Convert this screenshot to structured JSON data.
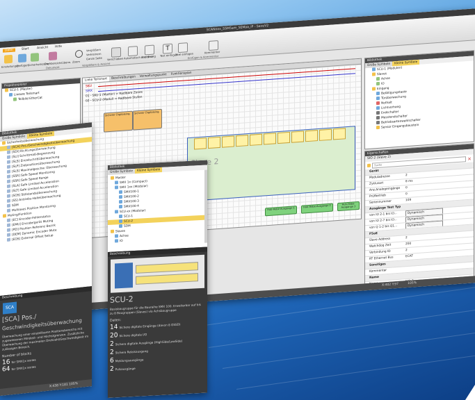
{
  "main": {
    "title": "SCANnex_SSM5am_5EMaa_iP - SaveV2",
    "ribbon_tabs": [
      "Datei",
      "Start",
      "Ansicht",
      "Hilfe"
    ],
    "ribbon": {
      "b1": "Einstellungen",
      "b2": "Einfügen",
      "b3": "Sicherheitszone",
      "b4": "Drehbereichsüberw.",
      "zoom_label": "Zoom",
      "vergroessern": "Vergrößern",
      "verkleinern": "Verkleinern",
      "ganzseite": "Ganze Seite",
      "verschieben": "Verschieben",
      "automatisch": "Automatisch anordnen",
      "anordnung": "Anordnung",
      "text": "Text einfügen",
      "titel": "Titel einfügen",
      "kommentar": "Kommentar",
      "drucken": "Drucken",
      "group_ansicht": "Vergrößern & Ansicht",
      "group_kommentar": "Einfügen & Kommentar",
      "dokument": "Dokument"
    },
    "project_tree": {
      "title": "Projektexplorer",
      "items": [
        "SCU-1 (Master)",
        "Lineare Teilsmart",
        "Teilbild EtherCat"
      ]
    },
    "canvas": {
      "tabs": [
        "Linke Teilsmart",
        "Beschreibungen",
        "Verwaltungspunkt",
        "Funktionsplan"
      ],
      "row1": "SKU",
      "row2": "SMX",
      "row3": "01 - SKU-1 (Master) > Radlbare Zones",
      "row4": "02 - SCU-2 (Modul) > Radlbare Stufen",
      "zone_label": "Slave 2",
      "green_block_1": "Hub-Hebe-Ausgänge 1",
      "green_block_2": "Hub-Hebe-Ausgänge 2",
      "green_block_3": "Hub-Hebe-Ausgänge 3",
      "module_a": "Sicherer Digitaleing.",
      "module_b": "Sicherer Digitaleing."
    },
    "library": {
      "title": "Bibliothek",
      "tab_big": "Große Symbole",
      "tab_small": "Kleine Symbole",
      "items": [
        "SCU-1 (Modulen)",
        "Slaves",
        "Achse",
        "IO",
        "Eingang",
        "Betätigungstaste",
        "Türüberwachung",
        "Nothalt",
        "Lichtvorhang",
        "Endschalter",
        "Messtendschalter",
        "Betriebsartenwahlschalter",
        "Sensor Eingangsbaustein"
      ]
    },
    "properties": {
      "title": "Eigenschaften",
      "header": "SIO-2 (Slave 2)",
      "search_placeholder": "Suche",
      "sections": {
        "geraet": "Gerät",
        "ausgaenge": "Ausgänge Test Typ",
        "fsoe": "FSoE",
        "sonstiges": "Sonstiges",
        "name": "Name"
      },
      "rows": [
        {
          "k": "Moduladresse",
          "v": "2"
        },
        {
          "k": "Zyklusart",
          "v": "8 ms"
        },
        {
          "k": "Anz.Analogeingänge",
          "v": "0"
        },
        {
          "k": "Prüfbetrieb",
          "v": "0"
        },
        {
          "k": "Seriennummer",
          "v": "109"
        }
      ],
      "test_rows": [
        {
          "k": "von IO 2-1 bis IO...",
          "v": "Dynamisch"
        },
        {
          "k": "von IO 2-7 bis IO...",
          "v": "Dynamisch"
        },
        {
          "k": "von Q 1-2 bis Q1...",
          "v": "Dynamisch"
        }
      ],
      "fsoe_rows": [
        {
          "k": "Slave Address",
          "v": "2"
        },
        {
          "k": "Watchdog Zeit",
          "v": "200"
        },
        {
          "k": "Verbindung ID",
          "v": "2"
        },
        {
          "k": "RT Ethernet Bus",
          "v": "ECAT"
        }
      ],
      "kommentar_label": "Kommentar",
      "name_label": "Name",
      "name_value": "SIO-2"
    },
    "status": {
      "coords": "X:402 Y:97",
      "zoom": "105%"
    }
  },
  "left_win": {
    "title": "Bibliothek",
    "tab_big": "Große Symbole",
    "tab_small": "Kleine Symbole",
    "root": "Sicherheitsüberwachung",
    "items": [
      "[SCA] Pos./Geschwindigkeitsüberwachung",
      "[SDI] Richtungsüberwachung",
      "[SLI] Schrittmaß-Begrenzung",
      "[SLS] Einzelschrittüberwachung",
      "[SLP] Zielpositionsüberwachung",
      "[SLS] Maximalgeschw. Überwachung",
      "[SSR] Safe Speed Monitoring",
      "[SSR] Safe Speed Range",
      "[SLA] Safe Limited Acceleration",
      "[SLT] Safe Limited Acceleration",
      "[SOS] Stillstandsüberwachung",
      "[SS] Antriebs-Halteüberwachung",
      "SDM",
      "Multiaxes Position Monitoring",
      "Muting/Funktion",
      "[EC] Encoder-Fehlerstatus",
      "[EMU] Encodergerät Muting",
      "[PEI] Position Referenz Bezirk",
      "[DEM] Dynamic Encoder Mute",
      "[EOS] External Offset Setup"
    ],
    "desc_title": "Beschreibung",
    "desc_badge": "SCA",
    "desc_heading1": "[SCA] Pos./",
    "desc_heading2": "Geschwindigkeitsüberwachung",
    "desc_text": "Überwachung einer einstellbaren Positionsbereichs mit zugewiesenen Mindest- und Höchstgrenzen. Zusätzliche Überwachung der maximalen Drehzahl/Geschwindigkeit im zulässigen Bereich.",
    "blocks_label": "Number of blocks",
    "blocks": [
      {
        "n": "16",
        "t": "for SMX1x series"
      },
      {
        "n": "64",
        "t": "for SMX1x series"
      }
    ],
    "status": "X:438 Y:181  105%"
  },
  "center_win": {
    "title": "Bibliothek",
    "tab_big": "Große Symbole",
    "tab_small": "Kleine Symbole",
    "items": [
      {
        "t": "Master",
        "lvl": 0
      },
      {
        "t": "SMX 1x (Compact)",
        "lvl": 1
      },
      {
        "t": "SMX 1xx (Modular)",
        "lvl": 1
      },
      {
        "t": "SMX100-1",
        "lvl": 2
      },
      {
        "t": "SMX100-2",
        "lvl": 2
      },
      {
        "t": "SMX100-3",
        "lvl": 2
      },
      {
        "t": "SMX100-4",
        "lvl": 2
      },
      {
        "t": "SCU-xx (Modular)",
        "lvl": 1
      },
      {
        "t": "SCU-1",
        "lvl": 2
      },
      {
        "t": "SCU-2",
        "lvl": 2
      },
      {
        "t": "SDM",
        "lvl": 2
      },
      {
        "t": "Slaves",
        "lvl": 0
      },
      {
        "t": "Achse",
        "lvl": 1
      },
      {
        "t": "IO",
        "lvl": 1
      }
    ],
    "desc_title": "Beschreibung",
    "heading": "SCU-2",
    "desc_text": "Basisbaugruppe für die Baureihe SMX 100. Erweiterbar auf bis zu 8 Baugruppen (Slaves) via Achsbaugruppe",
    "daten_label": "Daten:",
    "data": [
      {
        "n": "14",
        "t": "Sichere digitale Eingänge (davon 8 OSSD)"
      },
      {
        "n": "20",
        "t": "Sichere digitale I/O"
      },
      {
        "n": "2",
        "t": "Sichere digitale Ausgänge (HighSide/LowSide)"
      },
      {
        "n": "2",
        "t": "Sichere Relaisausgang"
      },
      {
        "n": "6",
        "t": "Meldungsausgänge"
      },
      {
        "n": "2",
        "t": "Pulsausgänge"
      }
    ]
  }
}
